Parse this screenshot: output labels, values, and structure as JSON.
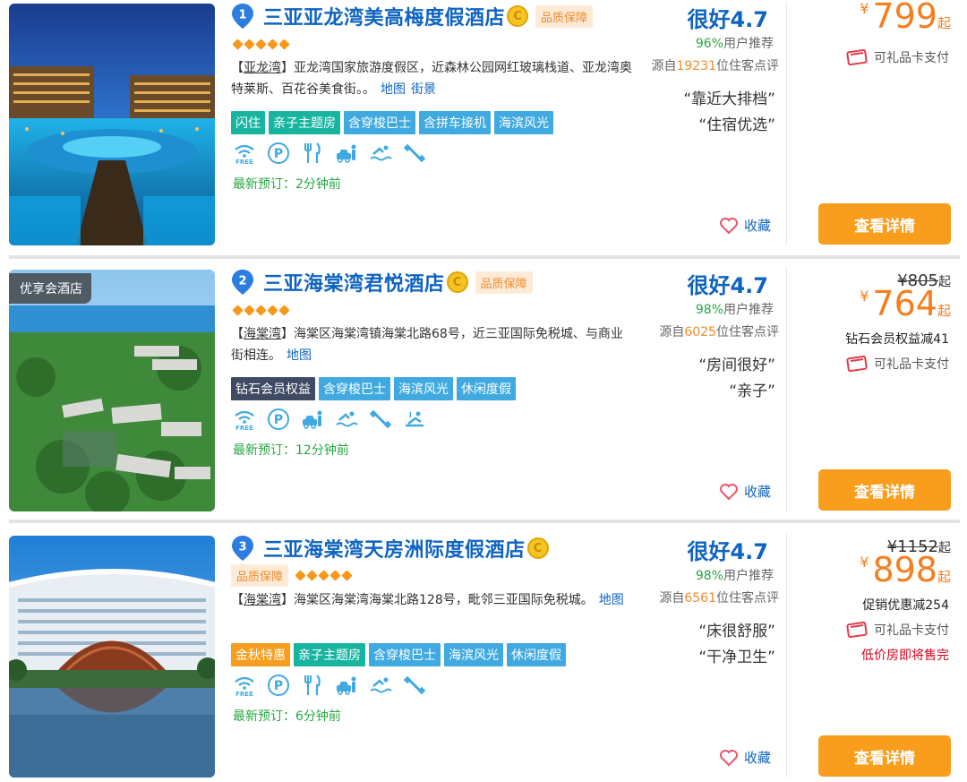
{
  "common": {
    "quality_badge": "品质保障",
    "favorite_label": "收藏",
    "detail_button": "查看详情",
    "gift_pay": "可礼品卡支付",
    "price_suffix": "起",
    "currency": "¥",
    "stars": 5
  },
  "hotels": [
    {
      "number": "1",
      "name": "三亚亚龙湾美高梅度假酒店",
      "photo_badge": "",
      "area": "亚龙湾",
      "address": "亚龙湾国家旅游度假区，近森林公园网红玻璃栈道、亚龙湾奥特莱斯、百花谷美食街。。",
      "links": [
        "地图",
        "街景"
      ],
      "tags": [
        {
          "label": "闪住",
          "color": "green"
        },
        {
          "label": "亲子主题房",
          "color": "green"
        },
        {
          "label": "含穿梭巴士",
          "color": "blue"
        },
        {
          "label": "含拼车接机",
          "color": "blue"
        },
        {
          "label": "海滨风光",
          "color": "blue"
        }
      ],
      "facility_icons": [
        "wifi-free-icon",
        "parking-icon",
        "restaurant-icon",
        "car-rental-icon",
        "swimming-icon",
        "gym-icon"
      ],
      "latest_booking": "最新预订：2分钟前",
      "rating_label": "很好",
      "score": "4.7",
      "recommend_pct": "96%",
      "recommend_label": "用户推荐",
      "review_prefix": "源自",
      "review_count": "19231",
      "review_suffix": "位住客点评",
      "quotes": [
        "“靠近大排档”",
        "“住宿优选”"
      ],
      "original_price": "",
      "price": "799",
      "promo": "",
      "low_stock": ""
    },
    {
      "number": "2",
      "name": "三亚海棠湾君悦酒店",
      "photo_badge": "优享会酒店",
      "area": "海棠湾",
      "address": "海棠区海棠湾镇海棠北路68号，近三亚国际免税城、与商业街相连。",
      "links": [
        "地图"
      ],
      "tags": [
        {
          "label": "钻石会员权益",
          "color": "navy"
        },
        {
          "label": "含穿梭巴士",
          "color": "blue"
        },
        {
          "label": "海滨风光",
          "color": "blue"
        },
        {
          "label": "休闲度假",
          "color": "blue"
        }
      ],
      "facility_icons": [
        "wifi-free-icon",
        "parking-icon",
        "car-rental-icon",
        "swimming-icon",
        "gym-icon",
        "spa-icon"
      ],
      "latest_booking": "最新预订：12分钟前",
      "rating_label": "很好",
      "score": "4.7",
      "recommend_pct": "98%",
      "recommend_label": "用户推荐",
      "review_prefix": "源自",
      "review_count": "6025",
      "review_suffix": "位住客点评",
      "quotes": [
        "“房间很好”",
        "“亲子”"
      ],
      "original_price": "¥805",
      "price": "764",
      "promo": "钻石会员权益减41",
      "low_stock": ""
    },
    {
      "number": "3",
      "name": "三亚海棠湾天房洲际度假酒店",
      "photo_badge": "",
      "area": "海棠湾",
      "address": "海棠区海棠湾海棠北路128号，毗邻三亚国际免税城。",
      "links": [
        "地图"
      ],
      "tags": [
        {
          "label": "金秋特惠",
          "color": "orange"
        },
        {
          "label": "亲子主题房",
          "color": "green"
        },
        {
          "label": "含穿梭巴士",
          "color": "blue"
        },
        {
          "label": "海滨风光",
          "color": "blue"
        },
        {
          "label": "休闲度假",
          "color": "blue"
        }
      ],
      "facility_icons": [
        "wifi-free-icon",
        "parking-icon",
        "restaurant-icon",
        "car-rental-icon",
        "swimming-icon",
        "gym-icon"
      ],
      "latest_booking": "最新预订：6分钟前",
      "rating_label": "很好",
      "score": "4.7",
      "recommend_pct": "98%",
      "recommend_label": "用户推荐",
      "review_prefix": "源自",
      "review_count": "6561",
      "review_suffix": "位住客点评",
      "quotes": [
        "“床很舒服”",
        "“干净卫生”"
      ],
      "original_price": "¥1152",
      "price": "898",
      "promo": "促销优惠减254",
      "low_stock": "低价房即将售完"
    }
  ],
  "colors": {
    "brand_blue": "#0f64c0",
    "price_orange": "#f57e1f",
    "button_orange": "#f99d1c",
    "recommend_green": "#28a745",
    "tag_green": "#17b4a0",
    "tag_blue": "#3fa9e0",
    "tag_navy": "#3f4a63",
    "tag_orange": "#f79d1f",
    "alert_red": "#d9001b"
  }
}
